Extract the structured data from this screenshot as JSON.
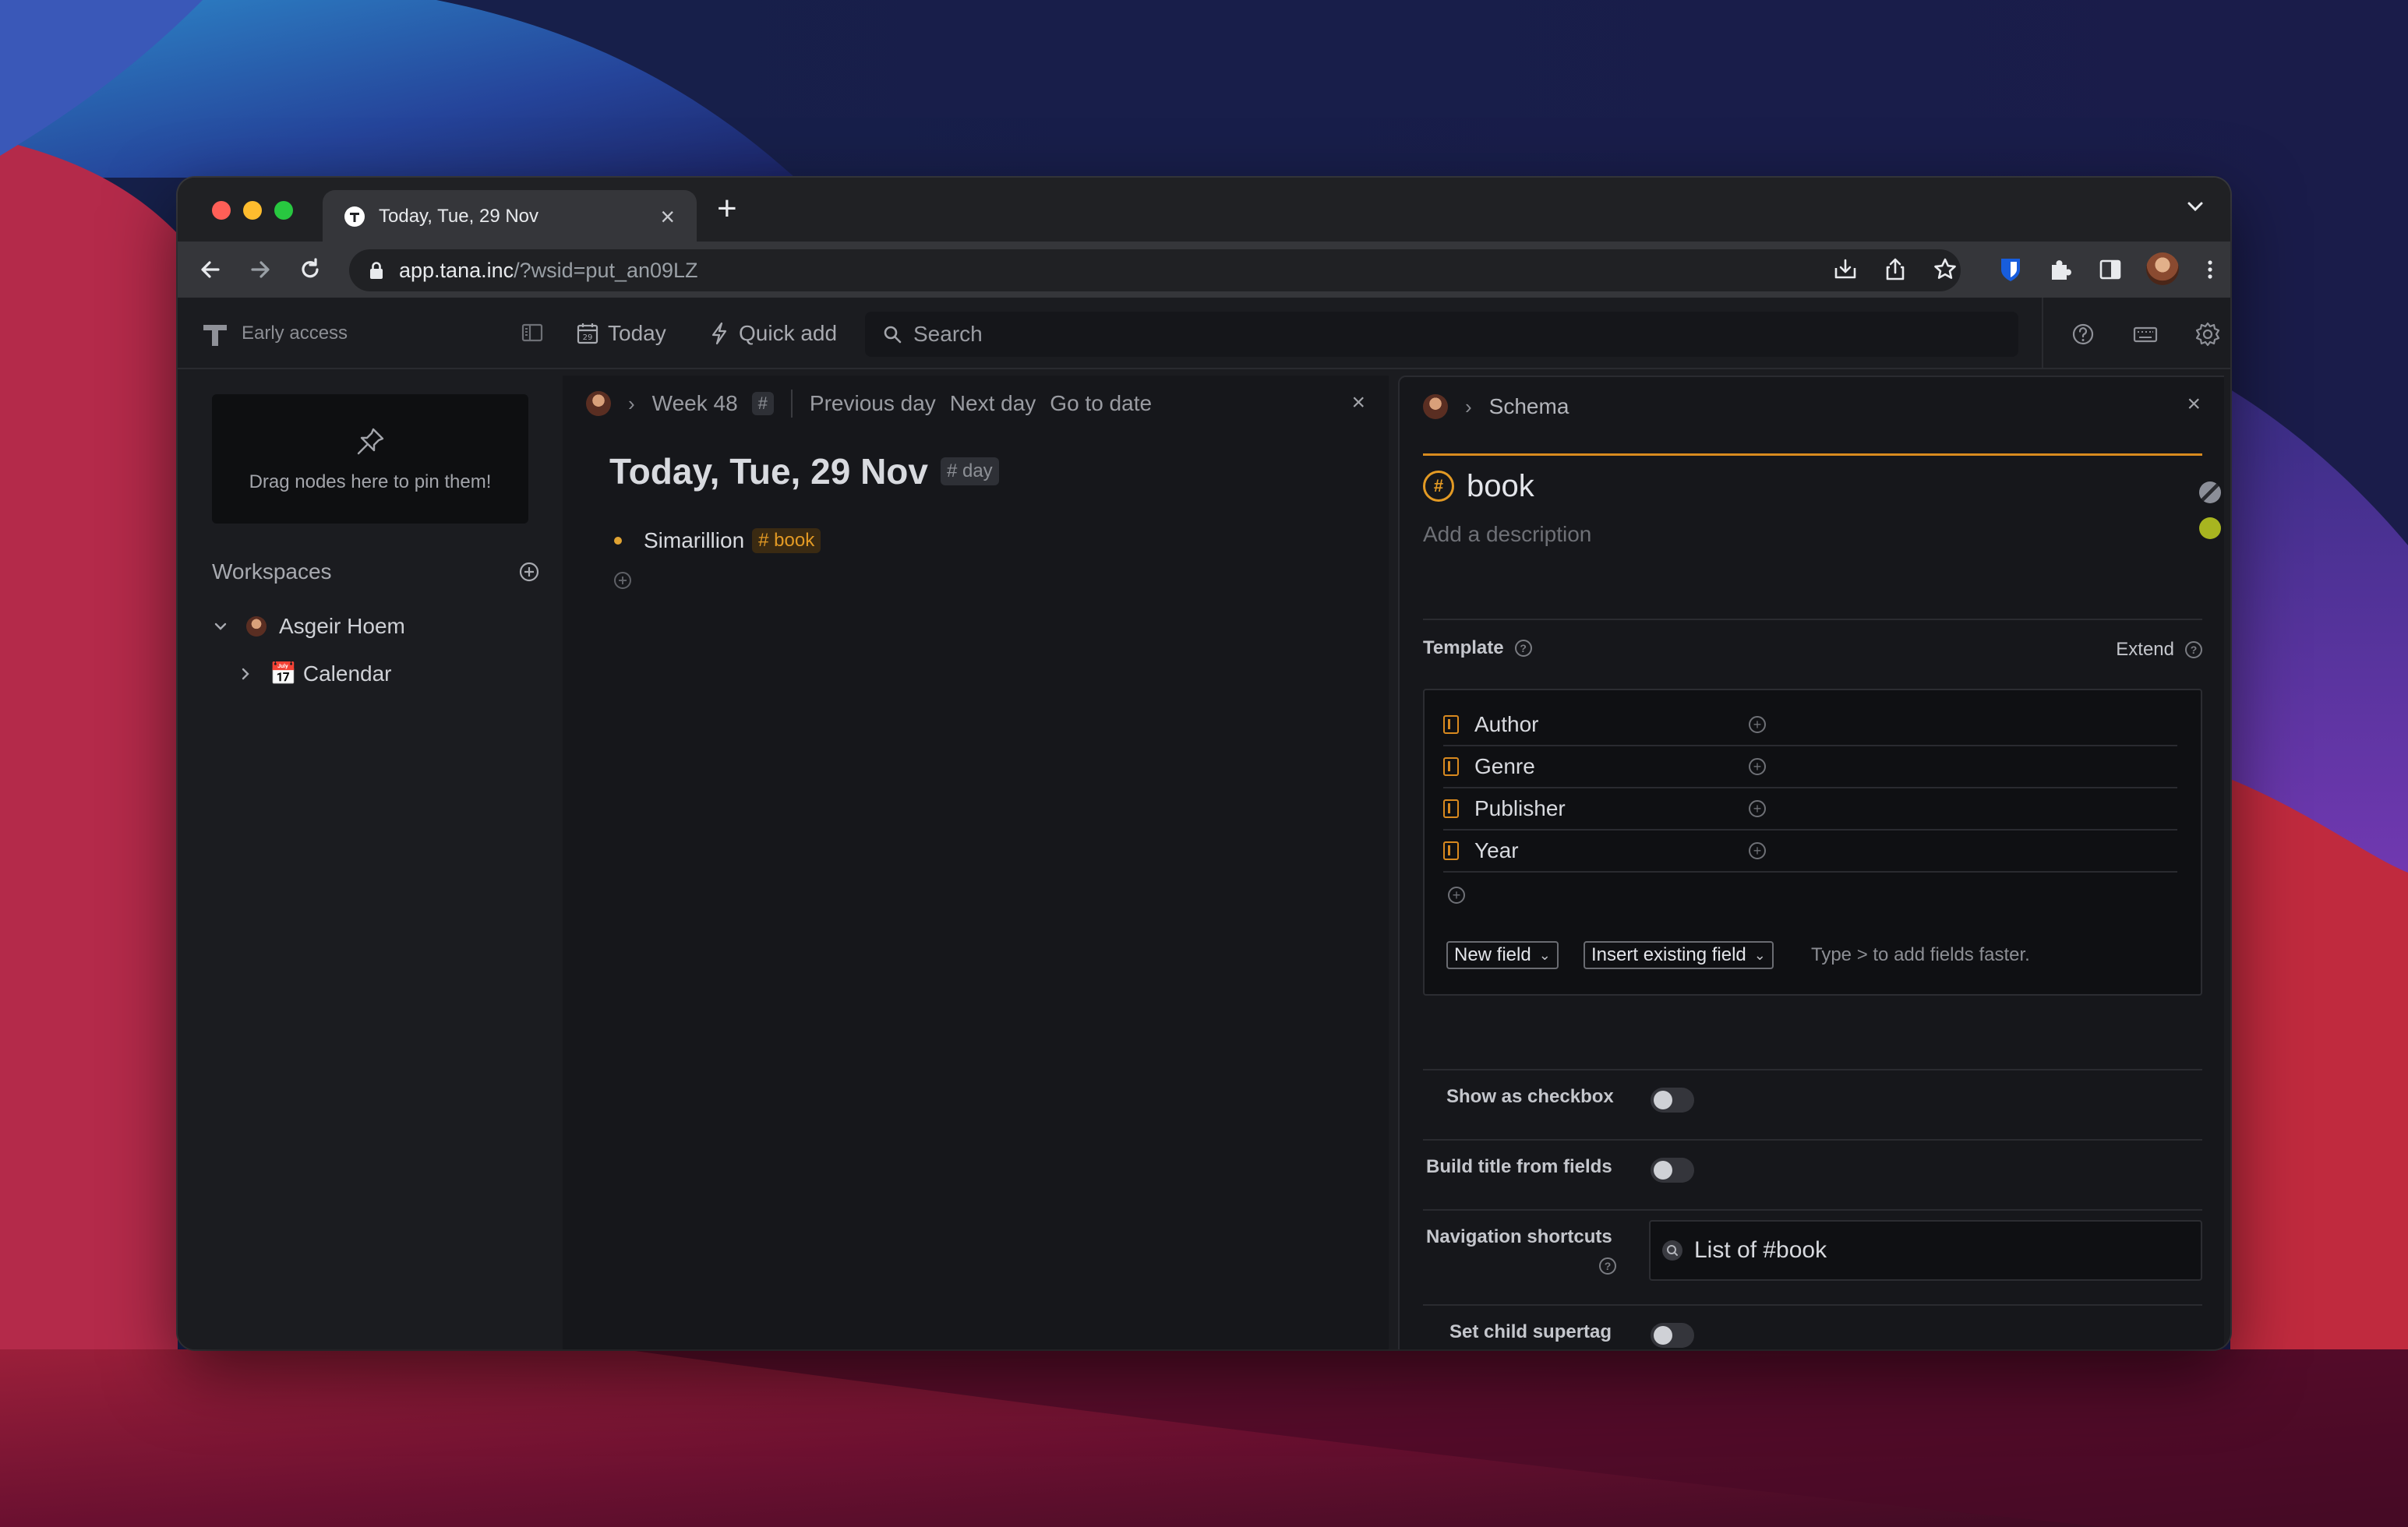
{
  "colors": {
    "accent": "#e39a24",
    "bg_app": "#1b1c20",
    "bg_panel": "#16171b",
    "swatches": [
      "#6b6e78",
      "#d6166f",
      "#c9142b",
      "#f08c00",
      "#e39a24",
      "#e2b400",
      "#a8b520",
      "#1fb08a",
      "#2172c9",
      "#2a7ef0",
      "#5a24d6",
      "#9b2fb5",
      "#f23ca5"
    ]
  },
  "browser": {
    "tab_title": "Today, Tue, 29 Nov",
    "url_host": "app.tana.inc",
    "url_path": "/?wsid=put_an09LZ",
    "icons": [
      "back-icon",
      "forward-icon",
      "reload-icon",
      "lock-icon",
      "install-icon",
      "share-icon",
      "star-icon",
      "bitwarden-icon",
      "extensions-icon",
      "sidepanel-icon",
      "profile-avatar",
      "menu-icon"
    ]
  },
  "topbar": {
    "early_access": "Early access",
    "today": "Today",
    "quick_add": "Quick add",
    "search": "Search"
  },
  "sidebar": {
    "pin_hint": "Drag nodes here to pin them!",
    "workspaces_title": "Workspaces",
    "workspace_name": "Asgeir Hoem",
    "calendar_emoji": "📅",
    "calendar_label": "Calendar"
  },
  "left_panel": {
    "week": "Week 48",
    "week_tag": "#",
    "prev_day": "Previous day",
    "next_day": "Next day",
    "go_to_date": "Go to date",
    "title": "Today, Tue, 29 Nov",
    "title_tag": "# day",
    "node_text": "Simarillion",
    "node_tag": "# book"
  },
  "schema_panel": {
    "crumb": "Schema",
    "name": "book",
    "description_placeholder": "Add a description",
    "template_label": "Template",
    "extend_label": "Extend",
    "fields": [
      "Author",
      "Genre",
      "Publisher",
      "Year"
    ],
    "new_field": "New field",
    "insert_existing": "Insert existing field",
    "hint": "Type > to add fields faster.",
    "options": {
      "show_checkbox": "Show as checkbox",
      "build_title": "Build title from fields",
      "nav_shortcuts": "Navigation shortcuts",
      "nav_shortcut_value": "List of #book",
      "child_supertag": "Set child supertag"
    }
  }
}
